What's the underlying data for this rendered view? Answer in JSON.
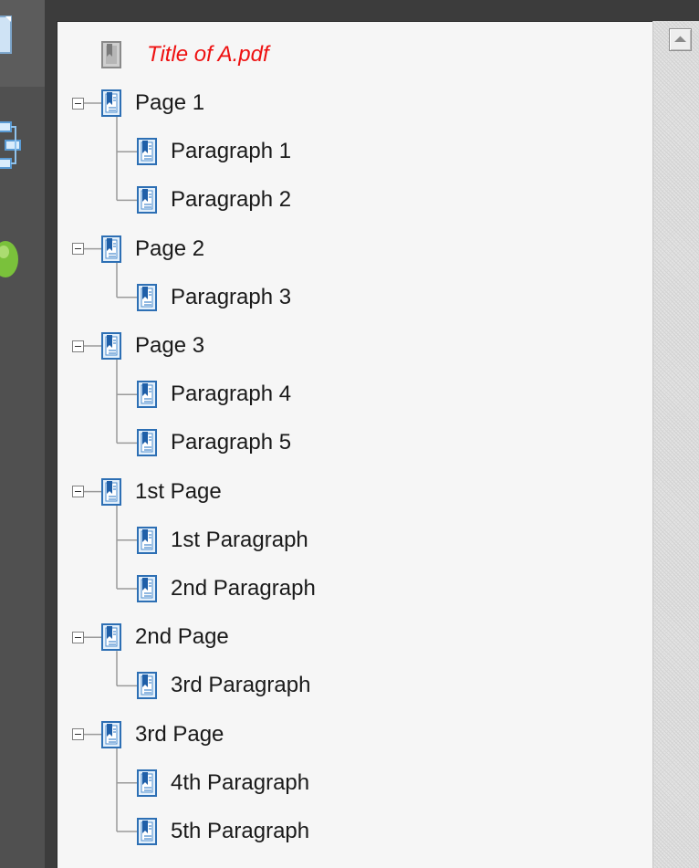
{
  "bookmarks": {
    "title": "Title of A.pdf",
    "groups": [
      {
        "label": "Page 1",
        "children": [
          "Paragraph 1",
          "Paragraph 2"
        ]
      },
      {
        "label": "Page 2",
        "children": [
          "Paragraph 3"
        ]
      },
      {
        "label": "Page 3",
        "children": [
          "Paragraph 4",
          "Paragraph 5"
        ]
      },
      {
        "label": "1st Page",
        "children": [
          "1st Paragraph",
          "2nd Paragraph"
        ]
      },
      {
        "label": "2nd Page",
        "children": [
          "3rd Paragraph"
        ]
      },
      {
        "label": "3rd Page",
        "children": [
          "4th Paragraph",
          "5th Paragraph"
        ]
      }
    ]
  },
  "colors": {
    "title_text": "#ee1111",
    "bookmark_icon_blue": "#2d6fb4",
    "bookmark_icon_grey": "#8a8a8a",
    "panel_bg": "#f6f6f6"
  },
  "icons": {
    "title_bookmark": "grey-bookmark-icon",
    "bookmark": "bookmark-icon",
    "expanded_toggle": "collapse-minus-icon",
    "scroll_up": "scroll-up-arrow-icon"
  }
}
